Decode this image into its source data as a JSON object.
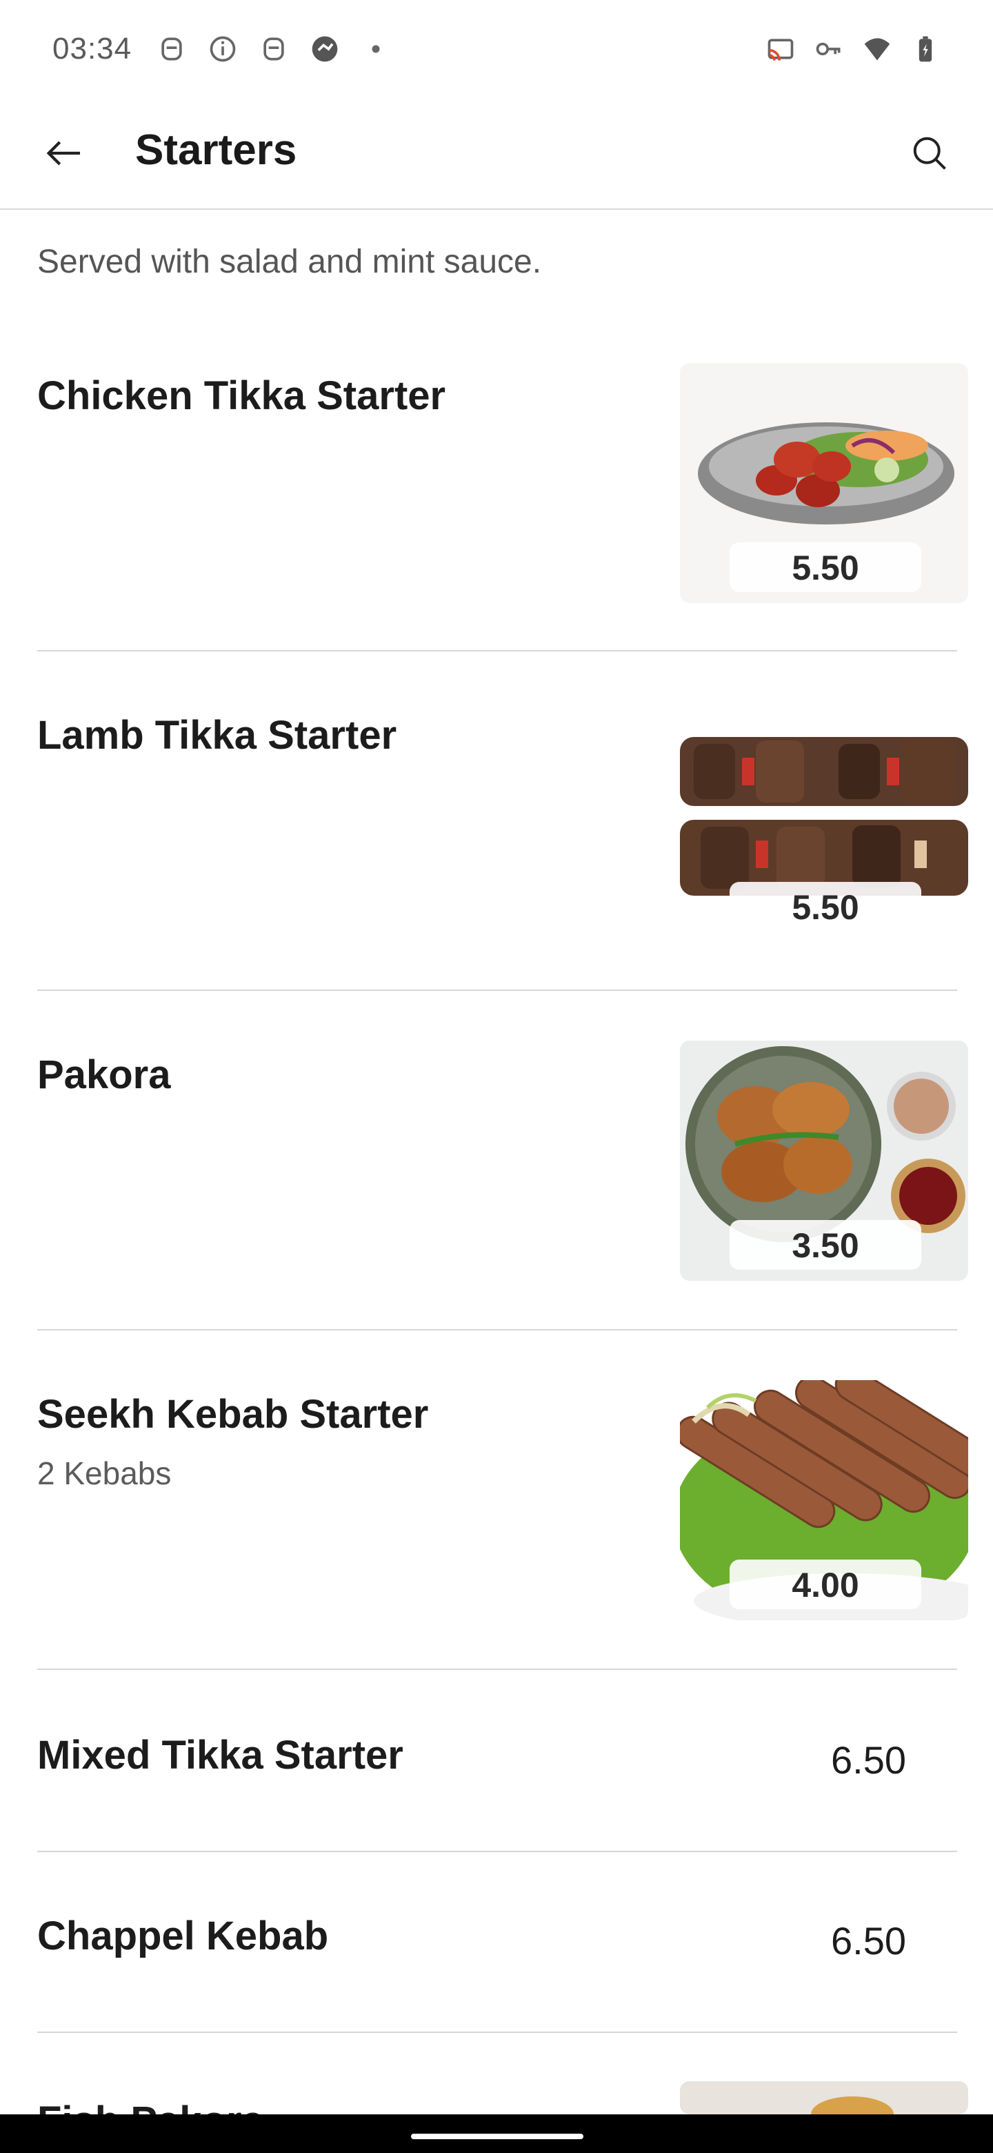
{
  "status_bar": {
    "time": "03:34",
    "left_icons": [
      "notification-icon",
      "info-icon",
      "notification-icon",
      "app-icon",
      "dot-icon"
    ],
    "right_icons": [
      "cast-icon",
      "key-icon",
      "wifi-icon",
      "battery-charging-icon"
    ]
  },
  "app_bar": {
    "title": "Starters",
    "back_icon": "arrow-left-icon",
    "search_icon": "search-icon"
  },
  "section": {
    "subtitle": "Served with salad and mint sauce."
  },
  "items": [
    {
      "name": "Chicken Tikka Starter",
      "description": "",
      "price": "5.50",
      "has_image": true,
      "image_icon": "chicken-tikka-photo"
    },
    {
      "name": "Lamb Tikka Starter",
      "description": "",
      "price": "5.50",
      "has_image": true,
      "image_icon": "lamb-tikka-photo"
    },
    {
      "name": "Pakora",
      "description": "",
      "price": "3.50",
      "has_image": true,
      "image_icon": "pakora-photo"
    },
    {
      "name": "Seekh Kebab Starter",
      "description": "2 Kebabs",
      "price": "4.00",
      "has_image": true,
      "image_icon": "seekh-kebab-photo"
    },
    {
      "name": "Mixed Tikka Starter",
      "description": "",
      "price": "6.50",
      "has_image": false
    },
    {
      "name": "Chappel Kebab",
      "description": "",
      "price": "6.50",
      "has_image": false
    },
    {
      "name": "Fish Pakora",
      "description": "",
      "price": "",
      "has_image": true,
      "image_icon": "fish-pakora-photo"
    }
  ],
  "colors": {
    "divider": "#d6d6d6",
    "title_text": "#1a1a1a",
    "secondary_text": "#555555"
  }
}
